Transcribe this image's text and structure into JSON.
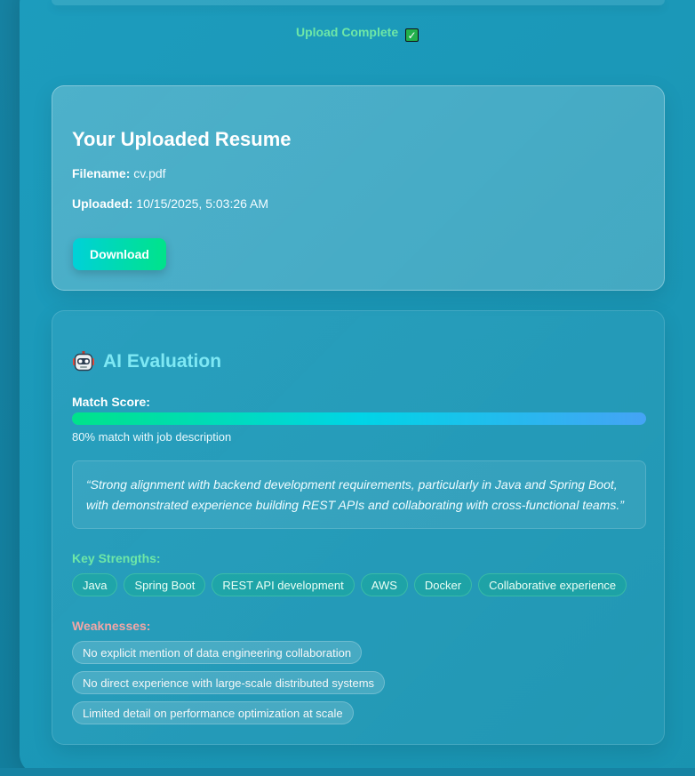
{
  "upload": {
    "status_text": "Upload Complete",
    "status_icon": "check-box-icon",
    "status_color": "#6ee7a7"
  },
  "resume": {
    "title": "Your Uploaded Resume",
    "filename_label": "Filename:",
    "filename_value": "cv.pdf",
    "uploaded_label": "Uploaded:",
    "uploaded_value": "10/15/2025, 5:03:26 AM",
    "download_label": "Download"
  },
  "evaluation": {
    "title": "AI Evaluation",
    "title_icon": "robot-icon",
    "match_label": "Match Score:",
    "match_score_percent": 80,
    "match_caption": "80% match with job description",
    "summary": "“Strong alignment with backend development requirements, particularly in Java and Spring Boot, with demonstrated experience building REST APIs and collaborating with cross-functional teams.”",
    "strengths_label": "Key Strengths:",
    "strengths": [
      "Java",
      "Spring Boot",
      "REST API development",
      "AWS",
      "Docker",
      "Collaborative experience"
    ],
    "weaknesses_label": "Weaknesses:",
    "weaknesses": [
      "No explicit mention of data engineering collaboration",
      "No direct experience with large-scale distributed systems",
      "Limited detail on performance optimization at scale"
    ],
    "colors": {
      "title": "#7ee8f4",
      "strengths": "#6ee7a7",
      "weaknesses": "#f3a6a6"
    }
  }
}
